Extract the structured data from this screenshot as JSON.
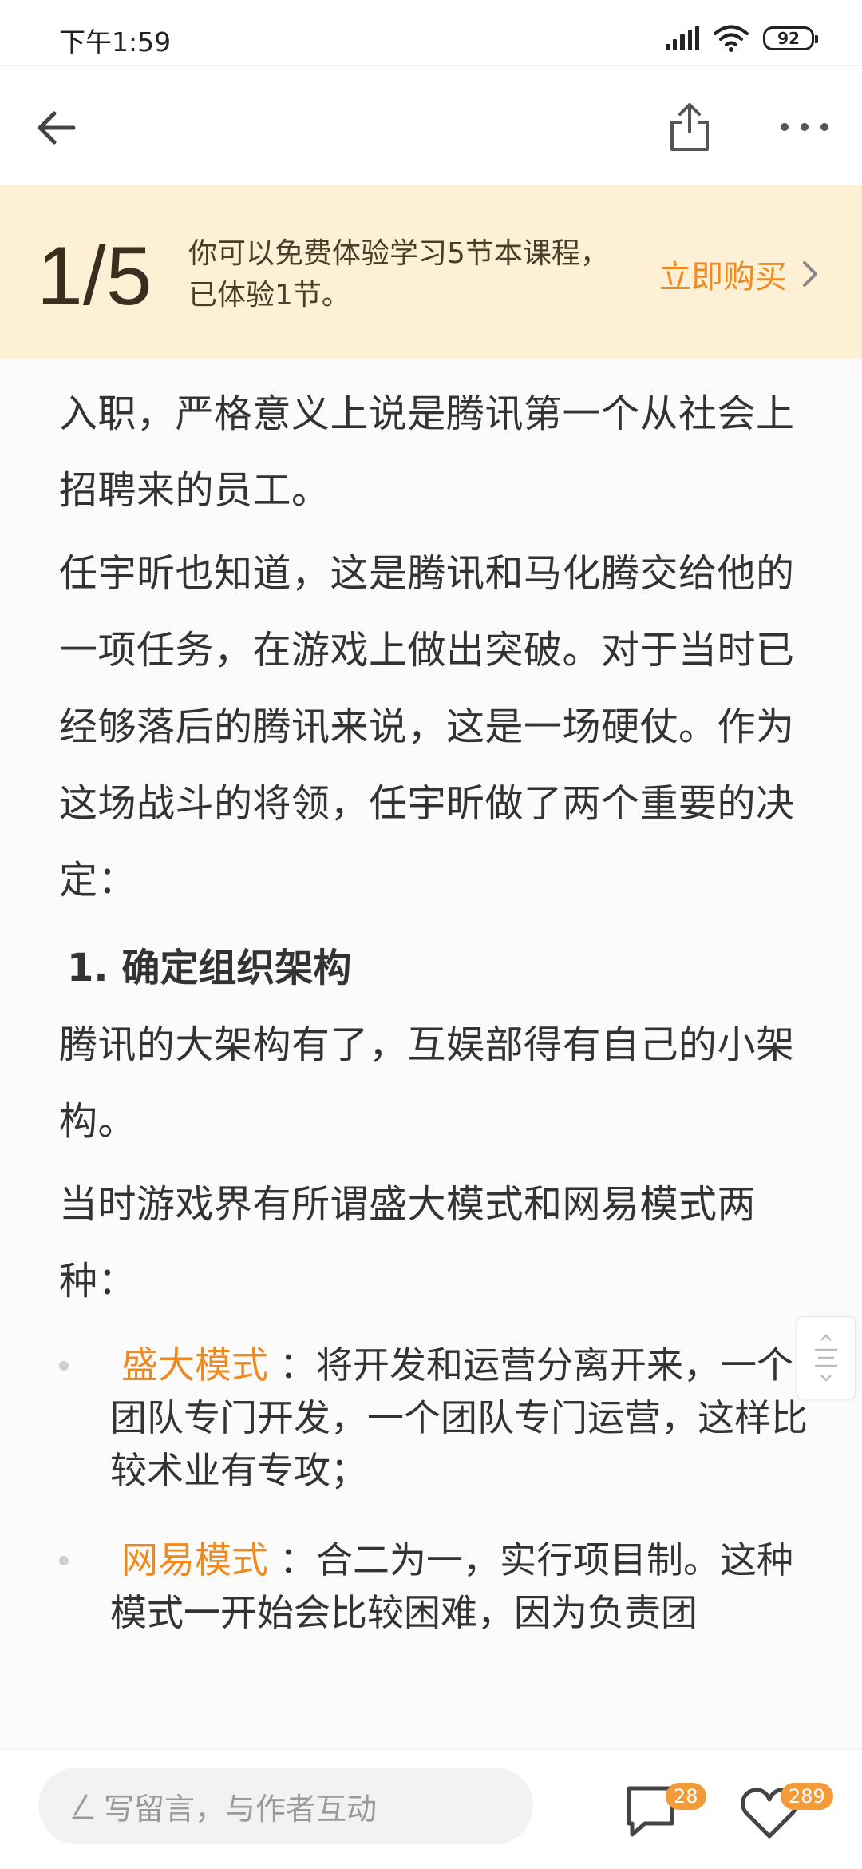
{
  "status_bar": {
    "time": "下午1:59",
    "battery": "92",
    "icons": [
      "signal-icon",
      "wifi-icon",
      "battery-icon"
    ]
  },
  "nav": {
    "icons": [
      "arrow-left-icon",
      "share-icon",
      "more-icon"
    ]
  },
  "trial": {
    "count": "1/5",
    "line1": "你可以免费体验学习5节本课程，",
    "line2": "已体验1节。",
    "buy_label": "立即购买"
  },
  "article": {
    "p1": "入职，严格意义上说是腾讯第一个从社会上招聘来的员工。",
    "p2": "任宇昕也知道，这是腾讯和马化腾交给他的一项任务，在游戏上做出突破。对于当时已经够落后的腾讯来说，这是一场硬仗。作为这场战斗的将领，任宇昕做了两个重要的决定：",
    "section_title": "1. 确定组织架构",
    "p3": "腾讯的大架构有了，互娱部得有自己的小架构。",
    "p4": "当时游戏界有所谓盛大模式和网易模式两种：",
    "bullets": [
      {
        "term": "盛大模式",
        "text": "：将开发和运营分离开来，一个团队专门开发，一个团队专门运营，这样比较术业有专攻；"
      },
      {
        "term": "网易模式",
        "text": "：合二为一，实行项目制。这种模式一开始会比较困难，因为负责团"
      }
    ]
  },
  "bottom_bar": {
    "comment_placeholder": "写留言，与作者互动",
    "comment_count": "28",
    "like_count": "289"
  },
  "colors": {
    "accent": "#ee8a1f",
    "banner_bg": "#fdf0d5",
    "badge": "#f29b38"
  }
}
